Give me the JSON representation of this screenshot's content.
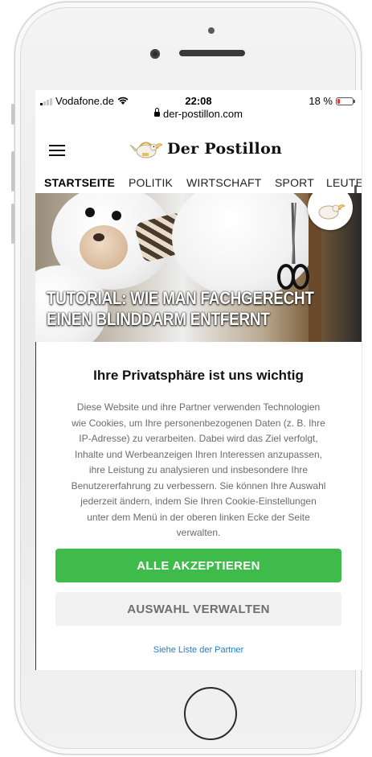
{
  "status_bar": {
    "carrier": "Vodafone.de",
    "time": "22:08",
    "battery_percent": "18 %",
    "battery_level": 0.18,
    "battery_color": "#ff2d2d"
  },
  "browser": {
    "url": "der-postillon.com"
  },
  "site": {
    "logo_text": "Der Postillon",
    "nav": [
      "STARTSEITE",
      "POLITIK",
      "WIRTSCHAFT",
      "SPORT",
      "LEUTE"
    ],
    "active_nav": "STARTSEITE"
  },
  "hero": {
    "title_line1": "TUTORIAL: WIE MAN FACHGERECHT",
    "title_line2": "EINEN BLINDDARM ENTFERNT"
  },
  "consent": {
    "title": "Ihre Privatsphäre ist uns wichtig",
    "body_lines": [
      "Diese Website und ihre Partner verwenden Technologien",
      "wie Cookies, um Ihre personenbezogenen Daten (z. B. Ihre",
      "IP-Adresse) zu verarbeiten. Dabei wird das Ziel verfolgt,",
      "Inhalte und Werbeanzeigen Ihren Interessen anzupassen,",
      "ihre Leistung zu analysieren und insbesondere Ihre",
      "Benutzererfahrung zu verbessern. Sie können Ihre Auswahl",
      "jederzeit ändern, indem Sie Ihren Cookie-Einstellungen",
      "unter dem Menü in der oberen linken Ecke der Seite",
      "verwalten."
    ],
    "accept_label": "ALLE AKZEPTIEREN",
    "manage_label": "AUSWAHL VERWALTEN",
    "partners_link": "Siehe Liste der Partner"
  },
  "colors": {
    "accept_green": "#3fbb4b",
    "link_blue": "#1a7fd6"
  }
}
